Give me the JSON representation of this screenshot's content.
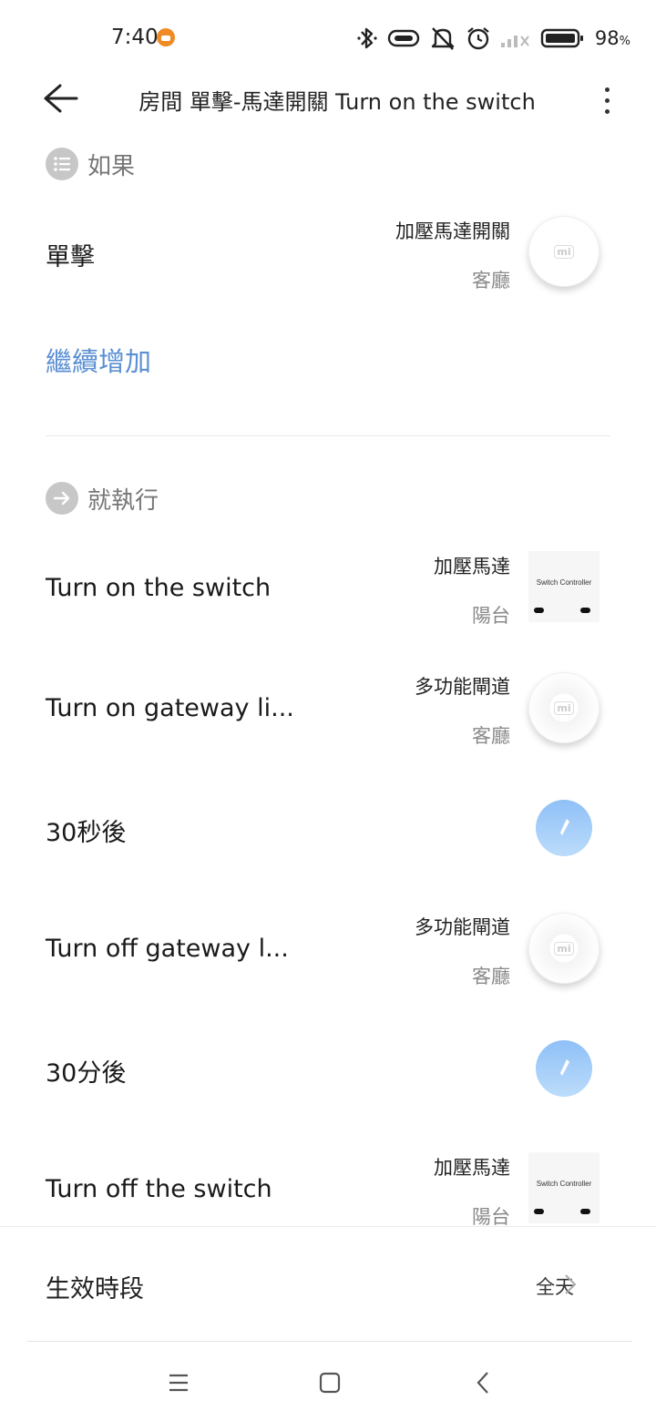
{
  "status_bar": {
    "time": "7:40",
    "battery_percent": "98",
    "battery_unit": "%",
    "icons": [
      "bluetooth-icon",
      "link-icon",
      "mute-icon",
      "alarm-icon",
      "signal-icon",
      "battery-icon"
    ]
  },
  "header": {
    "title": "房間 單擊-馬達開關 Turn on the switch"
  },
  "if_section": {
    "label": "如果",
    "condition": {
      "label": "單擊",
      "device": "加壓馬達開關",
      "room": "客廳"
    },
    "add_more": "繼續增加"
  },
  "then_section": {
    "label": "就執行",
    "actions": [
      {
        "label": "Turn on the switch",
        "device": "加壓馬達",
        "room": "陽台",
        "device_text": "Switch Controller"
      },
      {
        "label": "Turn on gateway li...",
        "device": "多功能閘道",
        "room": "客廳"
      },
      {
        "label": "30秒後"
      },
      {
        "label": "Turn off gateway l...",
        "device": "多功能閘道",
        "room": "客廳"
      },
      {
        "label": "30分後"
      },
      {
        "label": "Turn off the switch",
        "device": "加壓馬達",
        "room": "陽台",
        "device_text": "Switch Controller"
      }
    ]
  },
  "effective_period": {
    "label": "生效時段",
    "value": "全天"
  },
  "colors": {
    "accent": "#5a8fd3",
    "timer": "#a9cffa"
  }
}
